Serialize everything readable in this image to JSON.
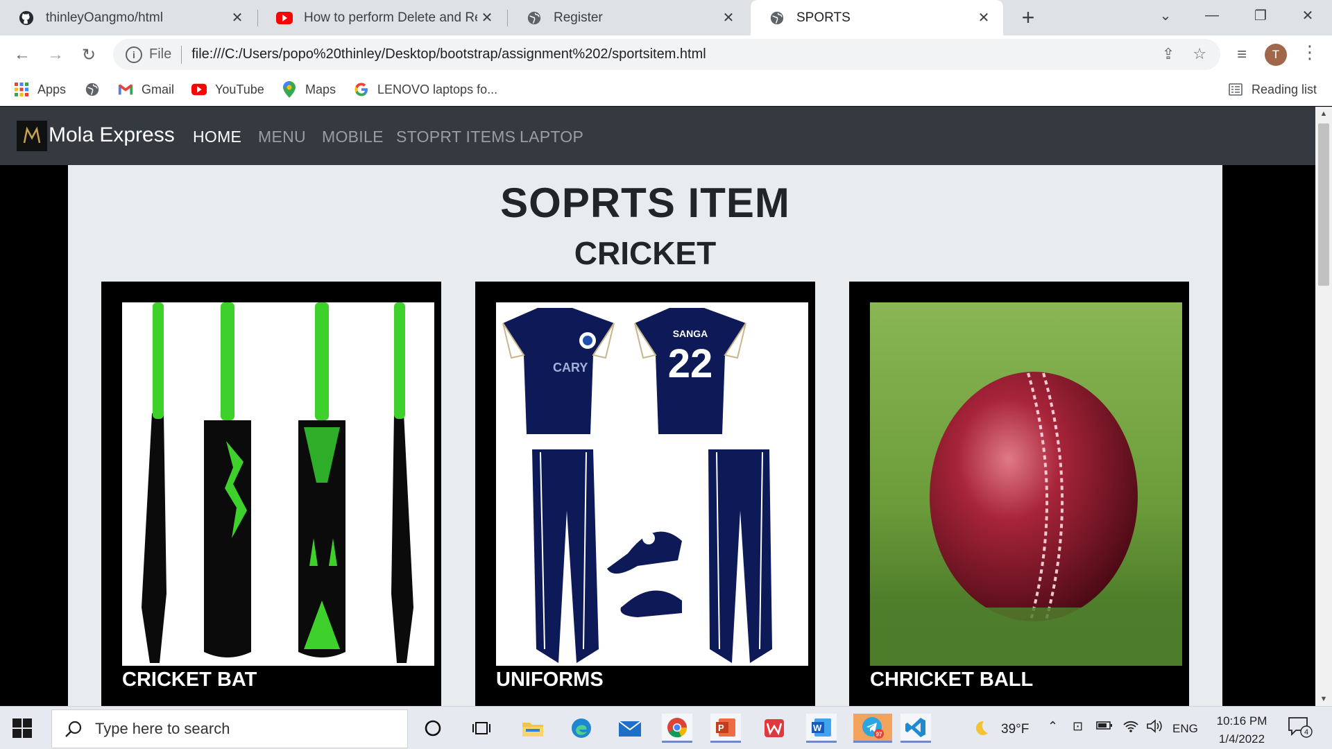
{
  "browser": {
    "tabs": [
      {
        "title": "thinleyOangmo/html",
        "icon": "github-icon"
      },
      {
        "title": "How to perform Delete and Rem",
        "icon": "youtube-icon"
      },
      {
        "title": "Register",
        "icon": "globe-icon"
      },
      {
        "title": "SPORTS",
        "icon": "globe-icon",
        "active": true
      }
    ],
    "omnibox": {
      "scheme": "File",
      "url": "file:///C:/Users/popo%20thinley/Desktop/bootstrap/assignment%202/sportsitem.html"
    },
    "profile_initial": "T",
    "bookmarks": [
      {
        "label": "Apps",
        "icon": "apps-grid-icon"
      },
      {
        "label": "",
        "icon": "globe-icon"
      },
      {
        "label": "Gmail",
        "icon": "gmail-icon"
      },
      {
        "label": "YouTube",
        "icon": "youtube-icon"
      },
      {
        "label": "Maps",
        "icon": "maps-icon"
      },
      {
        "label": "LENOVO laptops fo...",
        "icon": "google-icon"
      }
    ],
    "reading_list": "Reading list"
  },
  "site": {
    "brand": "Mola Express",
    "brand_logo_letter": "M",
    "nav": [
      {
        "label": "HOME",
        "active": true
      },
      {
        "label": "MENU"
      },
      {
        "label": "MOBILE"
      },
      {
        "label": "STOPRT ITEMS"
      },
      {
        "label": "LAPTOP"
      }
    ],
    "heading": "SOPRTS ITEM",
    "subheading": "CRICKET",
    "cards": [
      {
        "caption": "CRICKET BAT",
        "image": "cricket-bats-image"
      },
      {
        "caption": "UNIFORMS",
        "image": "cricket-uniform-image",
        "jersey_name": "SANGA",
        "jersey_number": "22",
        "shirt_logo": "CARY"
      },
      {
        "caption": "CHRICKET BALL",
        "image": "cricket-ball-image"
      }
    ]
  },
  "taskbar": {
    "search_placeholder": "Type here to search",
    "weather": "39°F",
    "language": "ENG",
    "time": "10:16 PM",
    "date": "1/4/2022",
    "notifications": "4",
    "telegram_badge": "97"
  },
  "colors": {
    "site_nav_bg": "#343a40",
    "container_bg": "#e9ecef",
    "card_bg": "#000000",
    "accent_green": "#3fd12b",
    "uniform_navy": "#0d1a57",
    "ball_red": "#9a1b2b"
  }
}
